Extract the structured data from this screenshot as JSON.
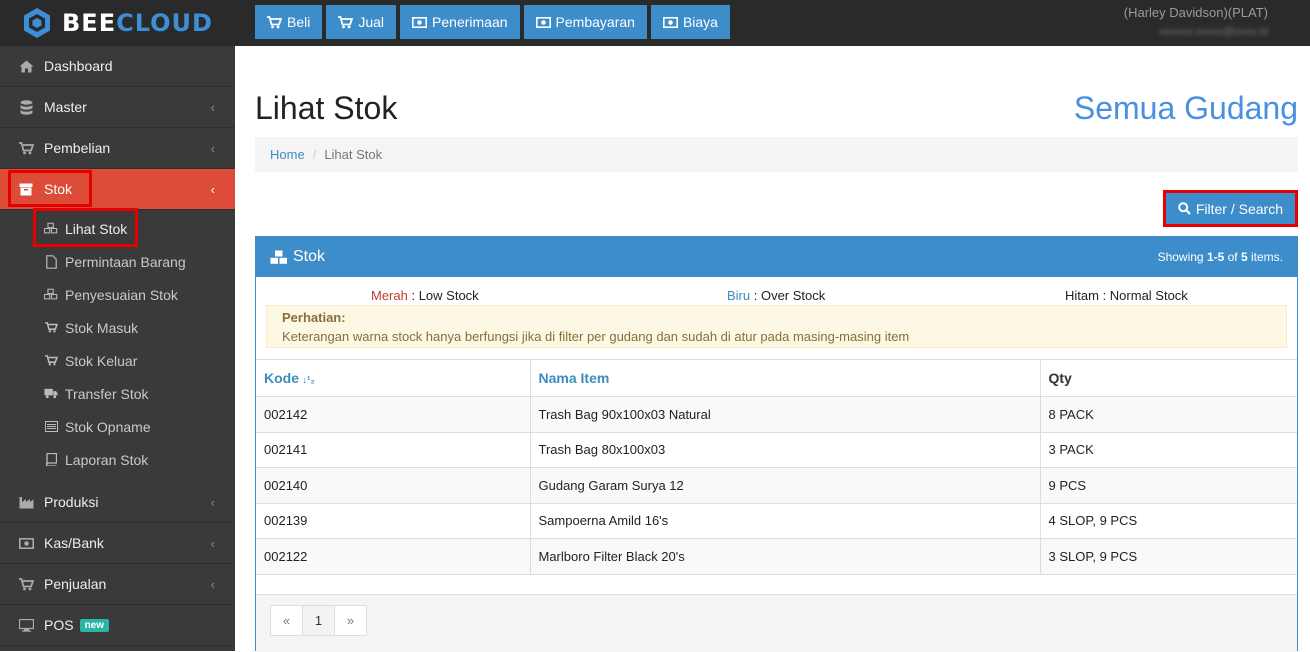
{
  "app": {
    "logo_bee": "BEE",
    "logo_cloud": "CLOUD"
  },
  "topnav": [
    {
      "label": "Beli",
      "icon": "cart-icon"
    },
    {
      "label": "Jual",
      "icon": "cart-icon"
    },
    {
      "label": "Penerimaan",
      "icon": "money-icon"
    },
    {
      "label": "Pembayaran",
      "icon": "money-icon"
    },
    {
      "label": "Biaya",
      "icon": "money-icon"
    }
  ],
  "user": {
    "name": "(Harley Davidson)(PLAT)",
    "email": "xxxxxx.xxxxx@xxxx.id"
  },
  "sidebar": {
    "items": [
      {
        "label": "Dashboard",
        "icon": "home-icon"
      },
      {
        "label": "Master",
        "icon": "database-icon"
      },
      {
        "label": "Pembelian",
        "icon": "cart-icon"
      },
      {
        "label": "Stok",
        "icon": "box-icon"
      }
    ],
    "stok_sub": [
      {
        "label": "Lihat Stok",
        "icon": "cubes-icon"
      },
      {
        "label": "Permintaan Barang",
        "icon": "file-icon"
      },
      {
        "label": "Penyesuaian Stok",
        "icon": "cubes-icon"
      },
      {
        "label": "Stok Masuk",
        "icon": "cart-icon"
      },
      {
        "label": "Stok Keluar",
        "icon": "cart-icon"
      },
      {
        "label": "Transfer Stok",
        "icon": "truck-icon"
      },
      {
        "label": "Stok Opname",
        "icon": "list-icon"
      },
      {
        "label": "Laporan Stok",
        "icon": "book-icon"
      }
    ],
    "bottom_items": [
      {
        "label": "Produksi",
        "icon": "industry-icon"
      },
      {
        "label": "Kas/Bank",
        "icon": "money-icon"
      },
      {
        "label": "Penjualan",
        "icon": "cart-icon"
      },
      {
        "label": "POS",
        "icon": "desktop-icon",
        "badge": "new"
      }
    ]
  },
  "page": {
    "title": "Lihat Stok",
    "right_title": "Semua Gudang",
    "breadcrumb": {
      "home": "Home",
      "current": "Lihat Stok"
    },
    "filter_button": "Filter / Search"
  },
  "panel": {
    "title": "Stok",
    "summary_prefix": "Showing ",
    "summary_range": "1-5",
    "summary_mid": " of ",
    "summary_total": "5",
    "summary_suffix": " items."
  },
  "legend": {
    "red_label": "Merah",
    "red_text": " : Low Stock",
    "blue_label": "Biru",
    "blue_text": " : Over Stock",
    "black_label": "Hitam",
    "black_text": " : Normal Stock"
  },
  "notice": {
    "title": "Perhatian:",
    "text": "Keterangan warna stock hanya berfungsi jika di filter per gudang dan sudah di atur pada masing-masing item"
  },
  "table": {
    "headers": {
      "kode": "Kode",
      "nama": "Nama Item",
      "qty": "Qty"
    },
    "rows": [
      {
        "kode": "002142",
        "nama": "Trash Bag 90x100x03 Natural",
        "qty": "8 PACK"
      },
      {
        "kode": "002141",
        "nama": "Trash Bag 80x100x03",
        "qty": "3 PACK"
      },
      {
        "kode": "002140",
        "nama": "Gudang Garam Surya 12",
        "qty": "9 PCS"
      },
      {
        "kode": "002139",
        "nama": "Sampoerna Amild 16's",
        "qty": "4 SLOP, 9 PCS"
      },
      {
        "kode": "002122",
        "nama": "Marlboro Filter Black 20's",
        "qty": "3 SLOP, 9 PCS"
      }
    ]
  },
  "pager": {
    "prev": "«",
    "current": "1",
    "next": "»"
  },
  "colors": {
    "accent": "#3c8dca",
    "active": "#dd4b39",
    "sidebar": "#3a3a3a",
    "topbar": "#2a2a2a",
    "highlight": "#e60000"
  }
}
